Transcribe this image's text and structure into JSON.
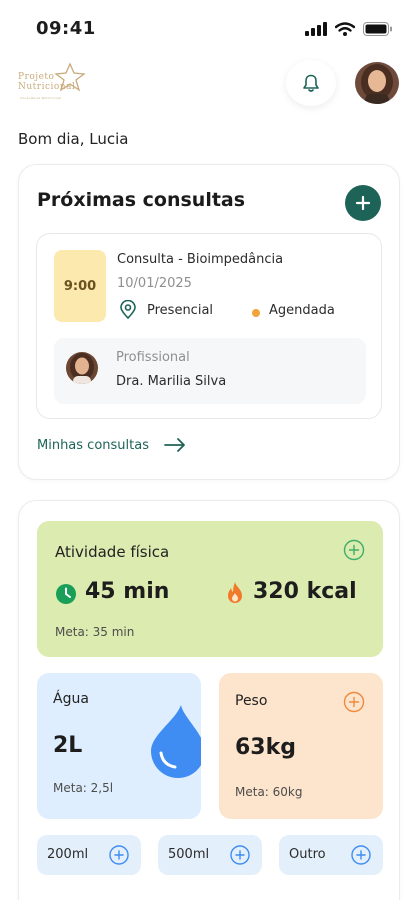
{
  "status_bar": {
    "time": "09:41"
  },
  "brand": {
    "logo_line1": "Projeto",
    "logo_line2": "Nutricional",
    "logo_tagline": "Consultoria Nutricional"
  },
  "greeting": "Bom dia, Lucia",
  "appointments": {
    "title": "Próximas consultas",
    "card": {
      "time": "9:00",
      "title": "Consulta - Bioimpedância",
      "date": "10/01/2025",
      "mode": "Presencial",
      "status": "Agendada",
      "professional_label": "Profissional",
      "professional_name": "Dra. Marilia Silva"
    },
    "link_label": "Minhas consultas"
  },
  "activity": {
    "title": "Atividade física",
    "minutes": "45 min",
    "kcal": "320 kcal",
    "goal": "Meta: 35 min"
  },
  "water": {
    "title": "Água",
    "value": "2L",
    "goal": "Meta: 2,5l"
  },
  "weight": {
    "title": "Peso",
    "value": "63kg",
    "goal": "Meta: 60kg"
  },
  "quick_add": [
    {
      "label": "200ml"
    },
    {
      "label": "500ml"
    },
    {
      "label": "Outro"
    }
  ],
  "colors": {
    "primary": "#1e6358",
    "activity_bg": "#dcebb0",
    "water_bg": "#dfeefe",
    "weight_bg": "#fde4cc",
    "time_box_bg": "#fbe9ad",
    "status_pending": "#f2a43a",
    "water_drop": "#3f8cf3",
    "fire": "#f07a2a"
  },
  "icons": [
    "signal-icon",
    "wifi-icon",
    "battery-icon",
    "bell-icon",
    "plus-icon",
    "location-pin-icon",
    "arrow-right-icon",
    "clock-icon",
    "fire-icon",
    "water-drop-icon",
    "plus-circle-icon"
  ]
}
